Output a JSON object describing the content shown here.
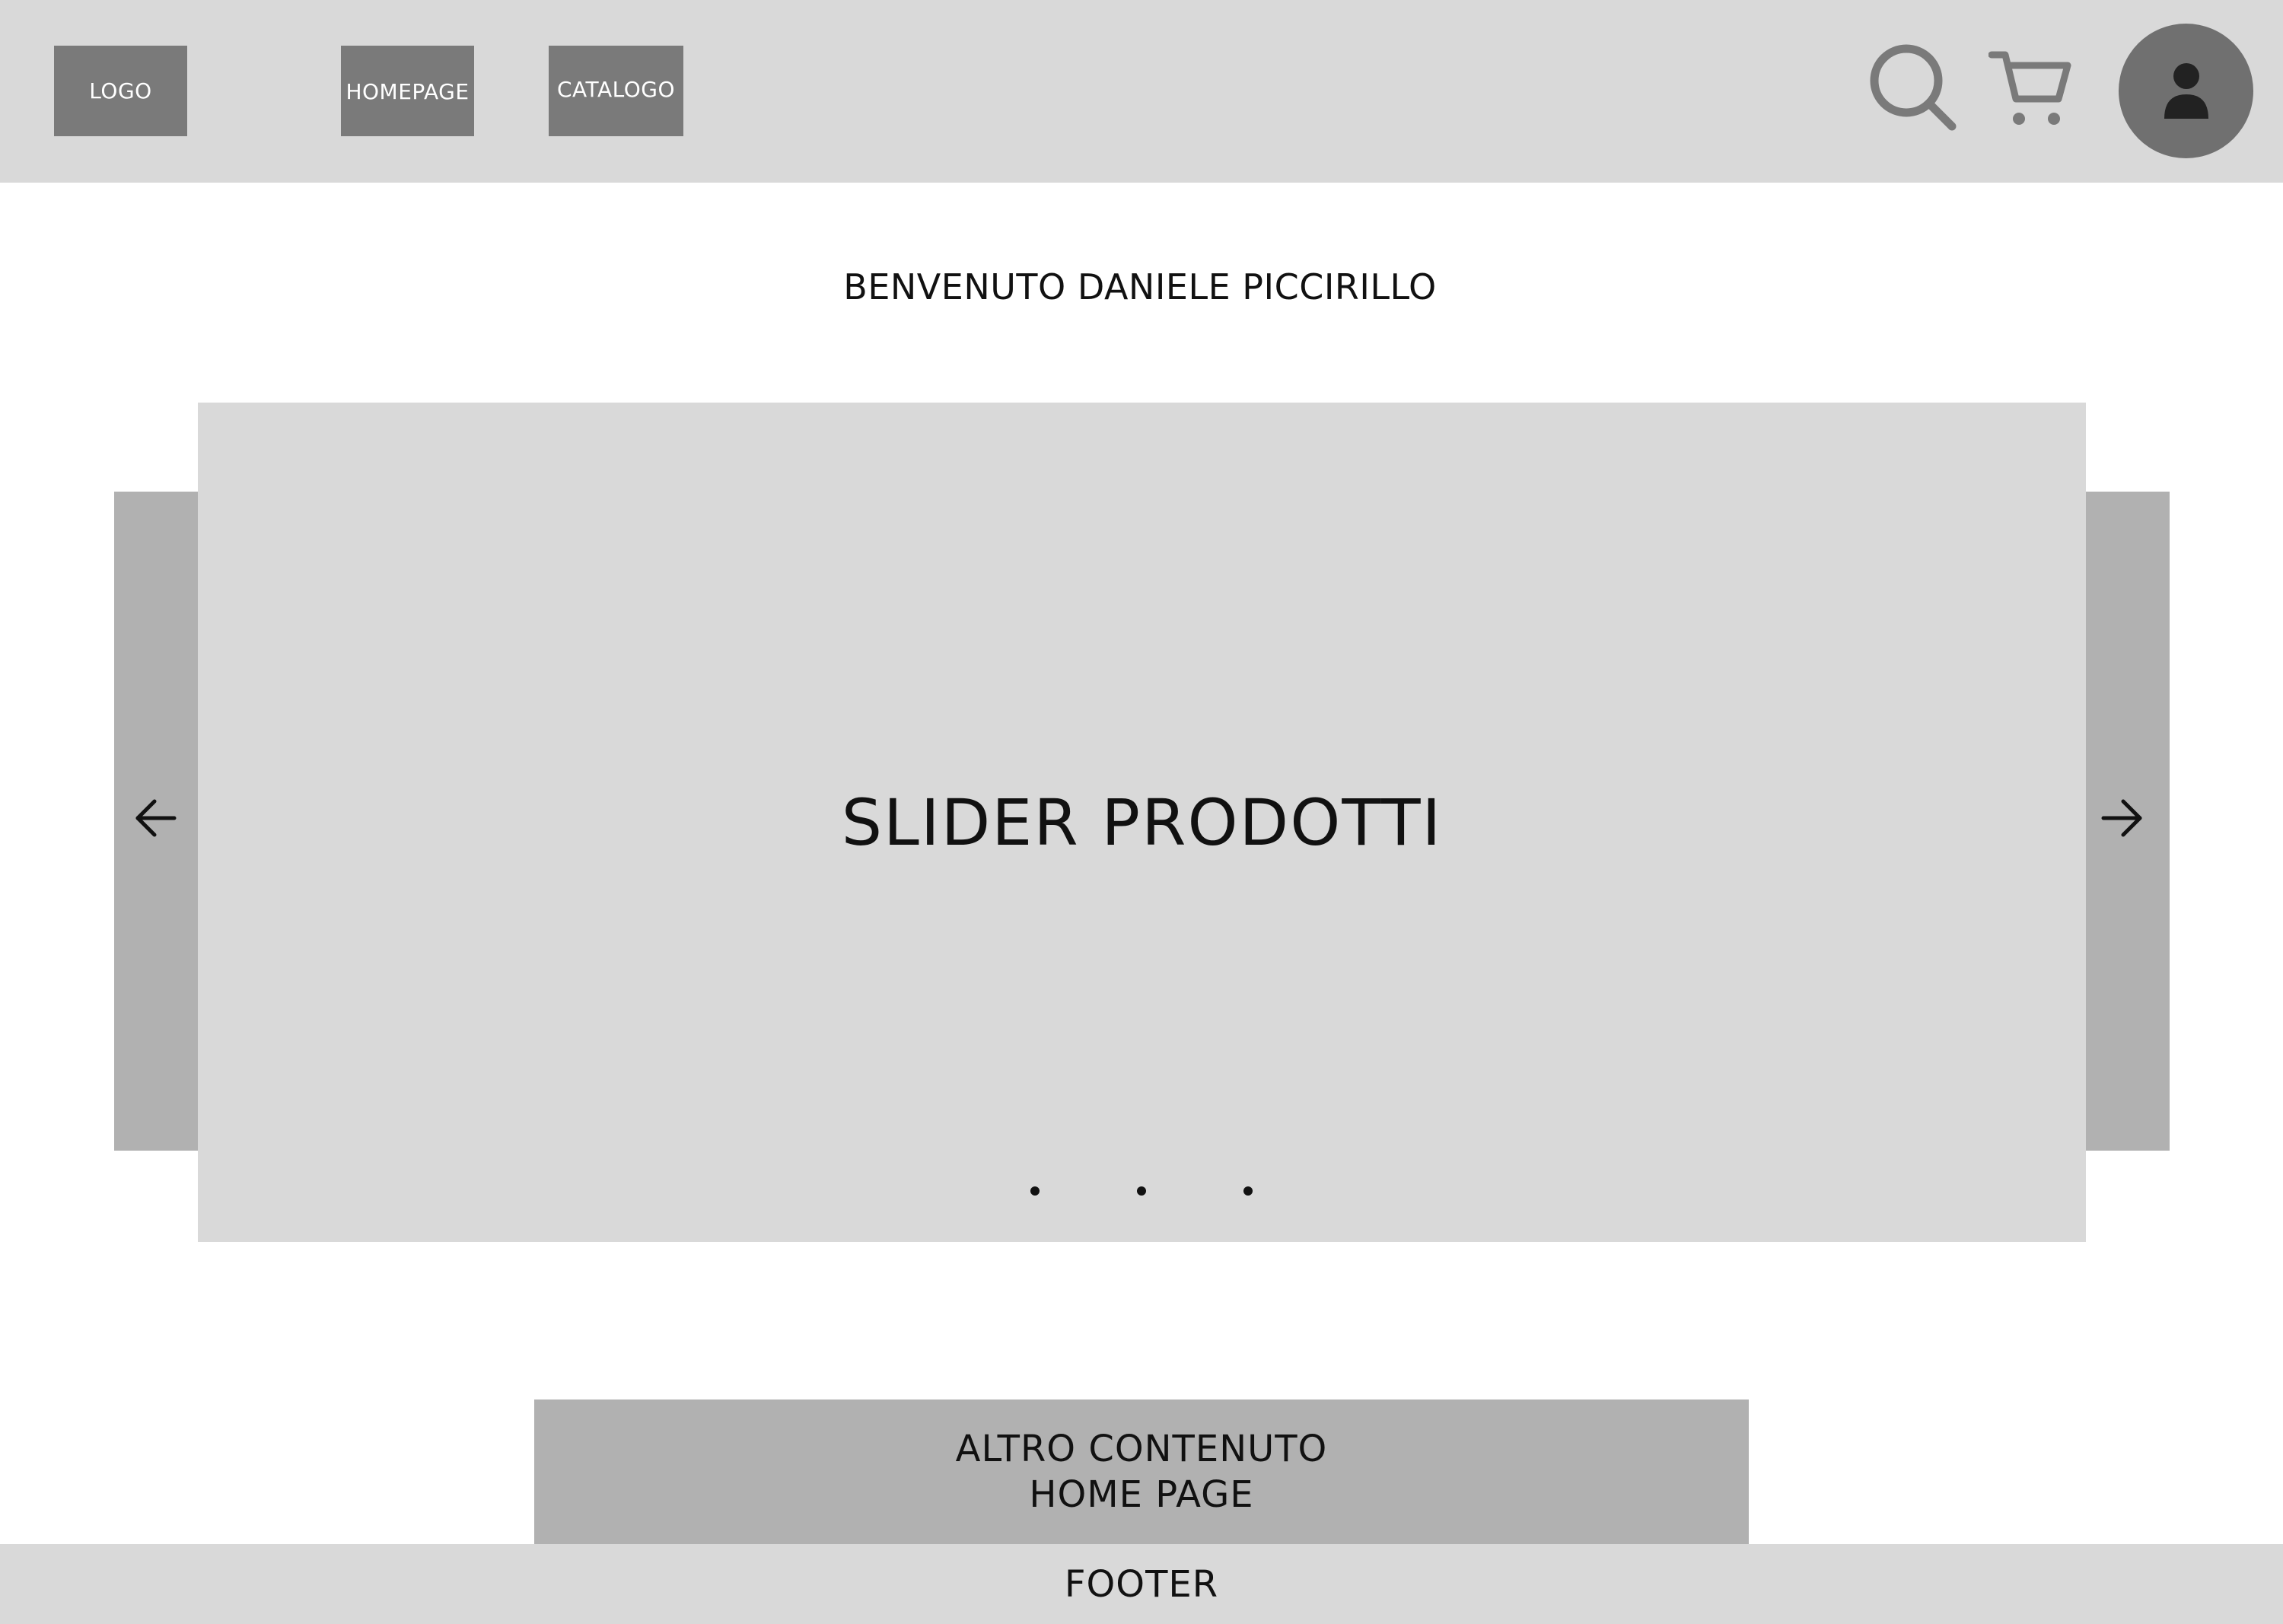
{
  "header": {
    "logo_label": "LOGO",
    "nav": [
      {
        "label": "HOMEPAGE"
      },
      {
        "label": "CATALOGO"
      }
    ],
    "icons": [
      "search-icon",
      "cart-icon",
      "user-icon"
    ]
  },
  "welcome": {
    "text": "BENVENUTO DANIELE PICCIRILLO"
  },
  "slider": {
    "title": "SLIDER PRODOTTI",
    "dot_count": 3,
    "icons": [
      "arrow-left-icon",
      "arrow-right-icon"
    ]
  },
  "other_content": {
    "line1": "ALTRO CONTENUTO",
    "line2": "HOME PAGE"
  },
  "footer": {
    "text": "FOOTER"
  },
  "colors": {
    "header_bg": "#d9d9d9",
    "nav_box": "#7a7a7a",
    "avatar_bg": "#707070",
    "slider_bg": "#d9d9d9",
    "slider_side_bg": "#b1b1b1",
    "content_block_bg": "#b1b1b1",
    "footer_bg": "#d9d9d9",
    "text": "#111111"
  }
}
